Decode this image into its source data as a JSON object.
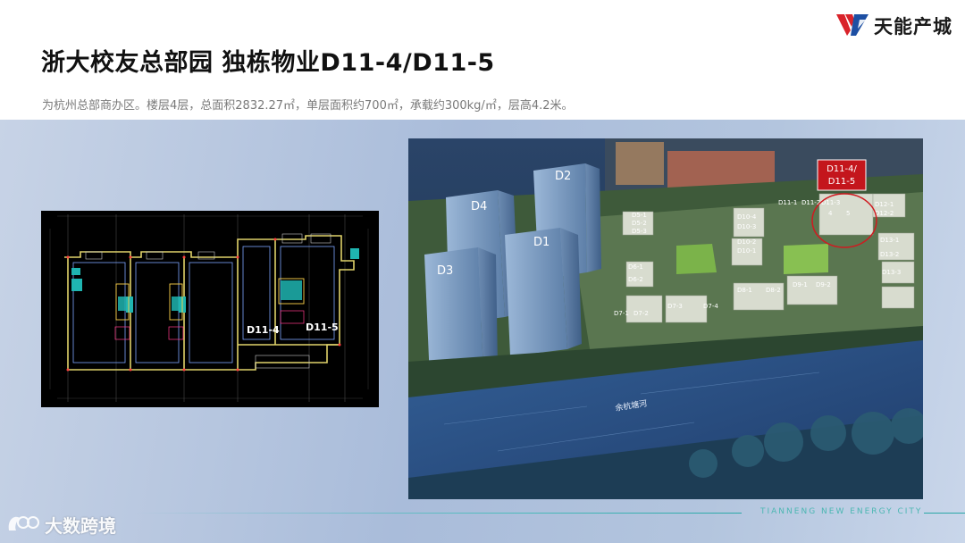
{
  "header": {
    "title": "浙大校友总部园 独栋物业D11-4/D11-5",
    "subtitle": "为杭州总部商办区。楼层4层，总面积2832.27㎡，单层面积约700㎡，承载约300kg/㎡，层高4.2米。"
  },
  "brand": {
    "name": "天能产城",
    "logo_icon": "tianneng-logo-icon",
    "logo_colors": [
      "#d9232a",
      "#1d4fa3"
    ]
  },
  "floorplan": {
    "label_left": "D11-4",
    "label_right": "D11-5"
  },
  "aerial": {
    "callout": "D11-4/\nD11-5",
    "callout_color": "#c4161c",
    "river_label": "余杭塘河",
    "towers": [
      "D1",
      "D2",
      "D3",
      "D4"
    ],
    "blocks": [
      "D5-1",
      "D5-2",
      "D5-3",
      "D6-1",
      "D6-2",
      "D7-1",
      "D7-2",
      "D7-3",
      "D7-4",
      "D8-1",
      "D8-2",
      "D9-1",
      "D9-2",
      "D10-1",
      "D10-2",
      "D10-3",
      "D10-4",
      "D11-1",
      "D11-2",
      "D11-3",
      "D11-4",
      "D11-5",
      "D12-1",
      "D12-2",
      "D13-1",
      "D13-2",
      "D13-3"
    ]
  },
  "footer": {
    "tagline": "TIANNENG NEW ENERGY CITY",
    "watermark": "大数跨境"
  },
  "draw_mode": "shaded"
}
